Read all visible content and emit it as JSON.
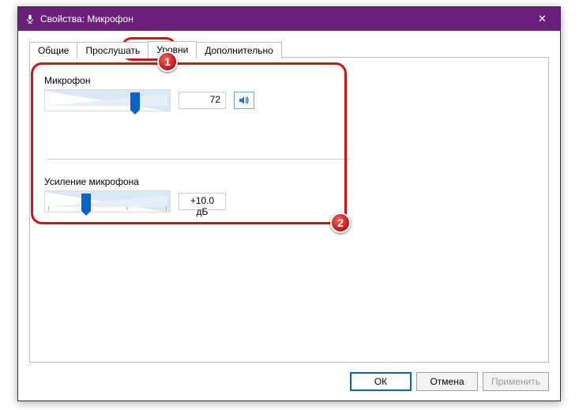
{
  "window": {
    "title": "Свойства: Микрофон",
    "close_label": "✕"
  },
  "tabs": [
    {
      "label": "Общие"
    },
    {
      "label": "Прослушать"
    },
    {
      "label": "Уровни"
    },
    {
      "label": "Дополнительно"
    }
  ],
  "active_tab_index": 2,
  "levels": {
    "mic": {
      "label": "Микрофон",
      "value": 72,
      "value_text": "72",
      "percent": 72
    },
    "boost": {
      "label": "Усиление микрофона",
      "value_db": 10.0,
      "value_text": "+10.0 дБ",
      "percent": 33
    }
  },
  "buttons": {
    "ok": "ОК",
    "cancel": "Отмена",
    "apply": "Применить"
  },
  "annotations": {
    "badge1": "1",
    "badge2": "2"
  }
}
